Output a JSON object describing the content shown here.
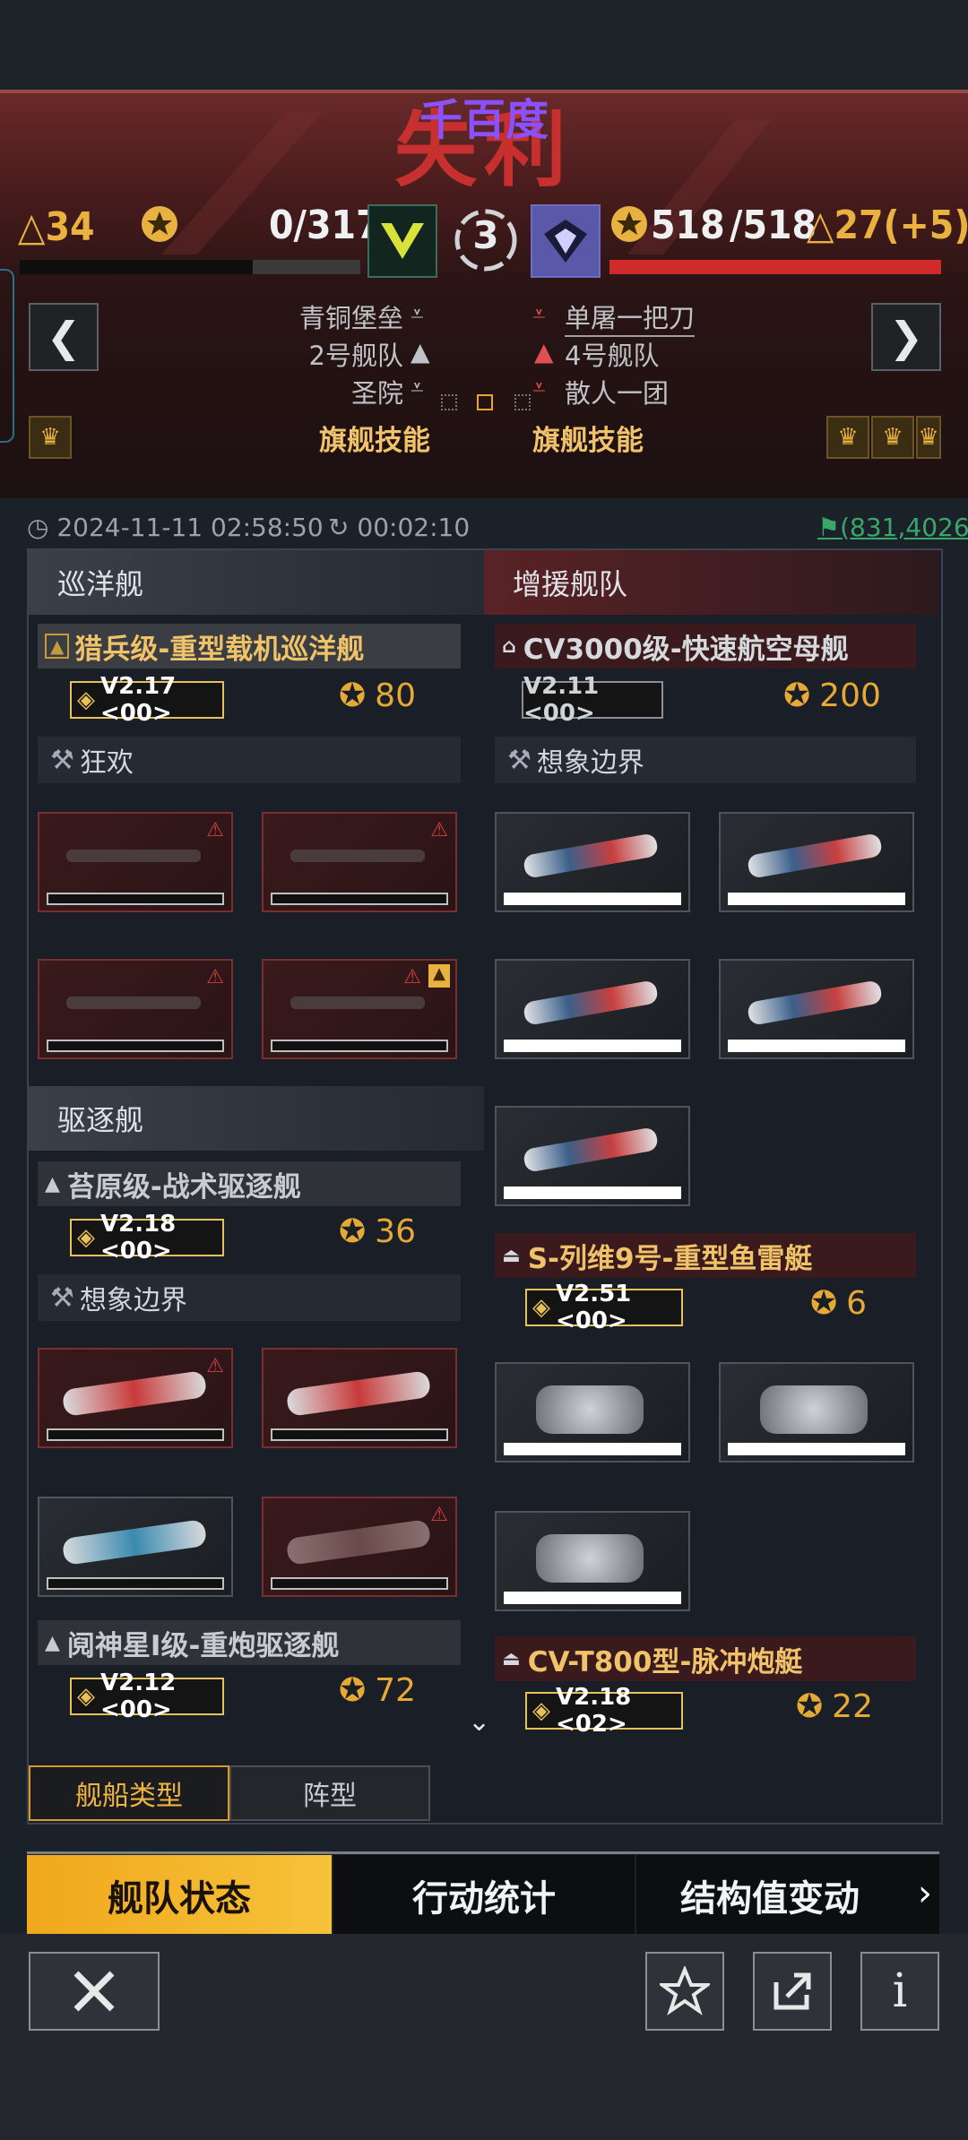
{
  "colors": {
    "accent_gold": "#e9b140",
    "enemy_red": "#c7302f",
    "panel_bg": "#1b2129"
  },
  "result": {
    "title": "失利",
    "overlay_text": "千百度"
  },
  "left_side": {
    "triangle_count": "34",
    "score": "0/317",
    "commander": "青铜堡垒",
    "fleet": "2号舰队",
    "faction": "圣院",
    "skill_label": "旗舰技能",
    "hp_fraction": 0
  },
  "right_side": {
    "score": "518",
    "score_total": "/518",
    "triangle_count": "27(+5)",
    "commander": "单屠一把刀",
    "fleet": "4号舰队",
    "faction": "散人一团",
    "skill_label": "旗舰技能",
    "hp_fraction": 1
  },
  "center": {
    "round": "3"
  },
  "nav": {
    "prev": "❮",
    "next": "❯"
  },
  "info": {
    "timestamp": "2024-11-11 02:58:50",
    "duration": "00:02:10",
    "coords": "(831,4026)"
  },
  "left_column": {
    "cruiser_header": "巡洋舰",
    "cruiser_ship": {
      "name": "猎兵级-重型载机巡洋舰",
      "version": "V2.17 <00>",
      "cost": "80",
      "faction": "狂欢"
    },
    "destroyer_header": "驱逐舰",
    "destroyer_ship": {
      "name": "苔原级-战术驱逐舰",
      "version": "V2.18 <00>",
      "cost": "36",
      "faction": "想象边界"
    },
    "destroyer2_ship": {
      "name": "阋神星I级-重炮驱逐舰",
      "version": "V2.12 <00>",
      "cost": "72"
    }
  },
  "right_column": {
    "header": "增援舰队",
    "carrier": {
      "name": "CV3000级-快速航空母舰",
      "version": "V2.11 <00>",
      "cost": "200",
      "faction": "想象边界"
    },
    "torpedo": {
      "name": "S-列维9号-重型鱼雷艇",
      "version": "V2.51 <00>",
      "cost": "6"
    },
    "gunboat": {
      "name": "CV-T800型-脉冲炮艇",
      "version": "V2.18 <02>",
      "cost": "22"
    }
  },
  "sub_tabs": [
    "舰船类型",
    "阵型"
  ],
  "main_tabs": [
    "舰队状态",
    "行动统计",
    "结构值变动"
  ],
  "footer_icons": [
    "close-icon",
    "star-icon",
    "share-icon",
    "info-icon"
  ]
}
